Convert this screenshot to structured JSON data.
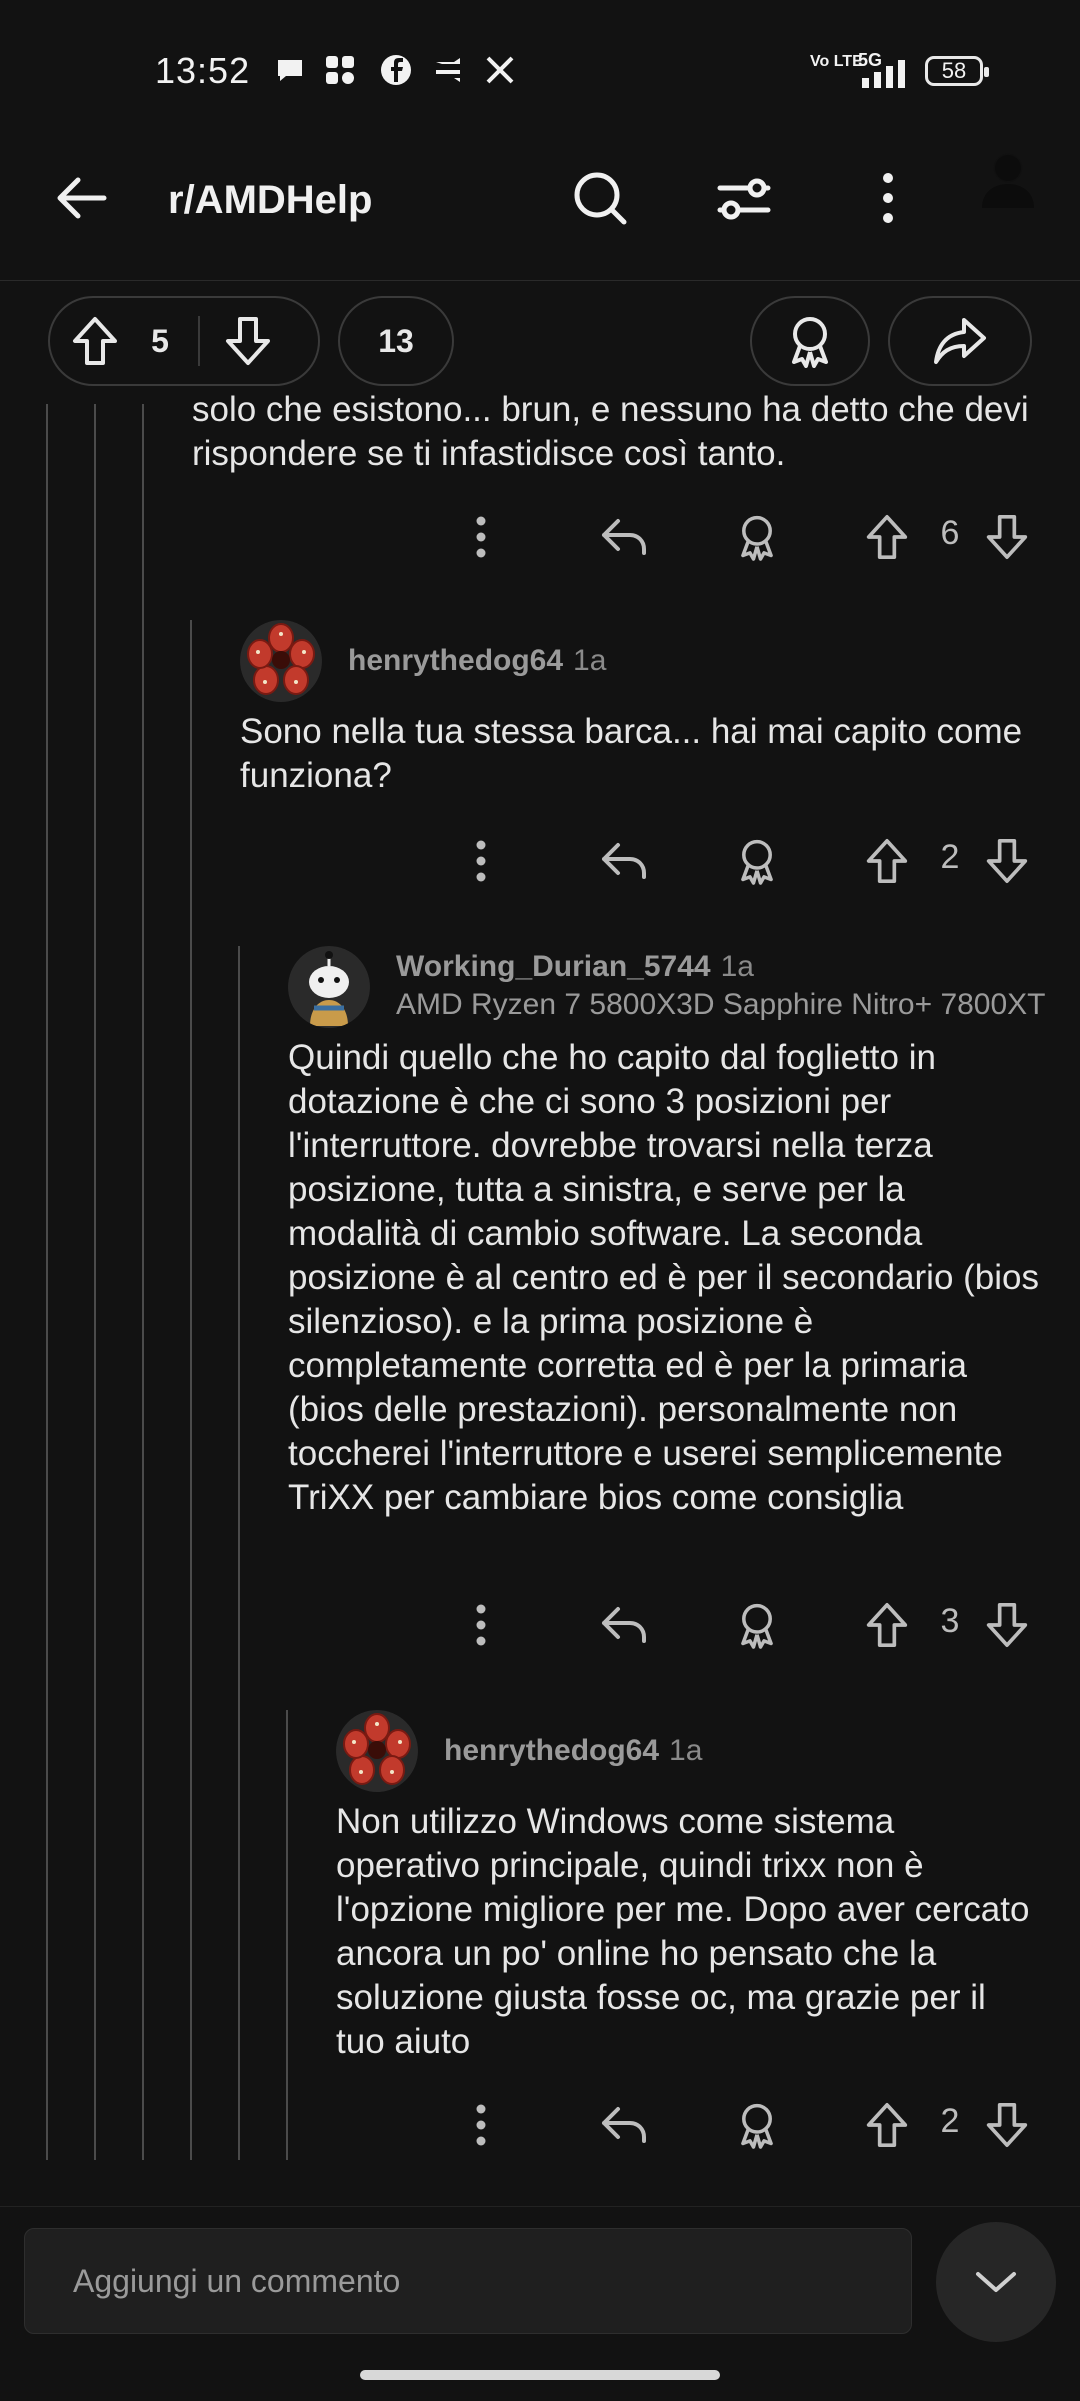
{
  "status_bar": {
    "time": "13:52",
    "signal_label": "Vo LTE",
    "network": "5G",
    "battery": "58"
  },
  "app_bar": {
    "title": "r/AMDHelp"
  },
  "post_actions": {
    "upvotes": "5",
    "comments": "13"
  },
  "comments": [
    {
      "text": "solo che esistono... brun, e nessuno ha detto che devi rispondere se ti infastidisce così tanto.",
      "votes": "6"
    },
    {
      "username": "henrythedog64",
      "age": "1a",
      "text": "Sono nella tua stessa barca... hai mai capito come funziona?",
      "votes": "2"
    },
    {
      "username": "Working_Durian_5744",
      "age": "1a",
      "flair": "AMD Ryzen 7 5800X3D Sapphire Nitro+ 7800XT",
      "text": "Quindi quello che ho capito dal foglietto in dotazione è che ci sono 3 posizioni per l'interruttore. dovrebbe trovarsi nella terza posizione, tutta a sinistra, e serve per la modalità di cambio software. La seconda posizione è al centro ed è per il secondario (bios silenzioso). e la prima posizione è completamente corretta ed è per la primaria (bios delle prestazioni). personalmente non toccherei l'interruttore e userei semplicemente TriXX per cambiare bios come consiglia",
      "votes": "3"
    },
    {
      "username": "henrythedog64",
      "age": "1a",
      "text": "Non utilizzo Windows come sistema operativo principale, quindi trixx non è l'opzione migliore per me. Dopo aver cercato ancora un po' online ho pensato che la soluzione giusta fosse oc, ma grazie per il tuo aiuto",
      "votes": "2"
    }
  ],
  "composer": {
    "placeholder": "Aggiungi un commento"
  },
  "icons": [
    "back-arrow-icon",
    "search-icon",
    "filter-icon",
    "more-vertical-icon",
    "profile-icon",
    "upvote-icon",
    "downvote-icon",
    "award-icon",
    "share-icon",
    "reply-icon",
    "chevron-down-icon"
  ]
}
